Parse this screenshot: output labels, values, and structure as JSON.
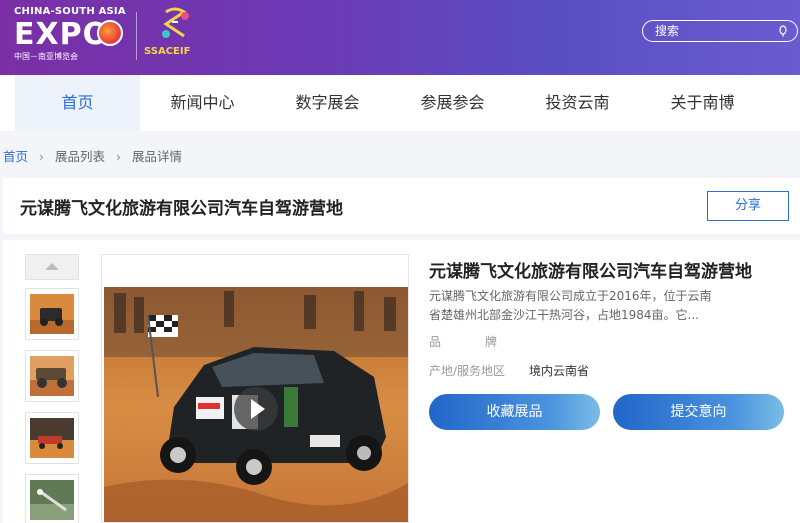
{
  "header": {
    "logo_line1": "CHINA-SOUTH ASIA",
    "logo_line2": "EXPO",
    "logo_line3": "中国－南亚博览会",
    "logo2_text": "SSACEIF",
    "search_placeholder": "搜索",
    "search_icon": "search-icon"
  },
  "nav": {
    "items": [
      {
        "label": "首页",
        "active": true
      },
      {
        "label": "新闻中心"
      },
      {
        "label": "数字展会"
      },
      {
        "label": "参展参会"
      },
      {
        "label": "投资云南"
      },
      {
        "label": "关于南博"
      }
    ]
  },
  "breadcrumb": [
    "首页",
    "展品列表",
    "展品详情"
  ],
  "page": {
    "title": "元谋腾飞文化旅游有限公司汽车自驾游营地",
    "share_label": "分享"
  },
  "product": {
    "title": "元谋腾飞文化旅游有限公司汽车自驾游营地",
    "description": "元谋腾飞文化旅游有限公司成立于2016年，位于云南省楚雄州北部金沙江干热河谷，占地1984亩。它...",
    "brand_label": "品牌",
    "brand_value": "",
    "origin_label": "产地/服务地区",
    "origin_value": "境内云南省",
    "collect_label": "收藏展品",
    "submit_label": "提交意向"
  },
  "colors": {
    "accent": "#2a6fd6",
    "header_gradient_start": "#7a2fa6",
    "header_gradient_end": "#6a5bd0"
  }
}
